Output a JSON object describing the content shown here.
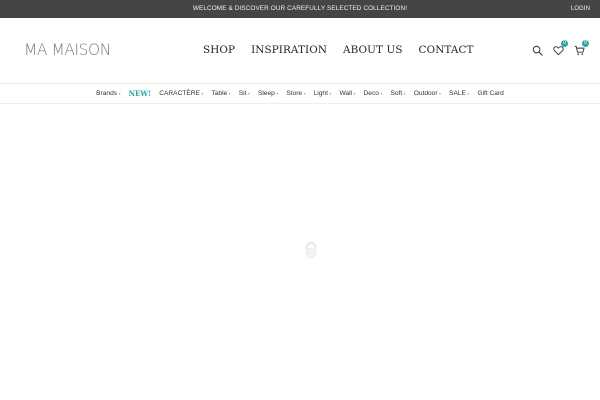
{
  "topbar": {
    "welcome": "WELCOME & DISCOVER OUR CAREFULLY SELECTED COLLECTION!",
    "login": "LOGIN"
  },
  "header": {
    "logo": "MA MAISON",
    "nav": [
      "SHOP",
      "INSPIRATION",
      "ABOUT US",
      "CONTACT"
    ],
    "wishlist_count": "0",
    "cart_count": "0"
  },
  "categories": [
    {
      "label": "Brands",
      "has_dropdown": true
    },
    {
      "label": "NEW!",
      "has_dropdown": false,
      "highlight": true
    },
    {
      "label": "CARACTÈRE",
      "has_dropdown": true
    },
    {
      "label": "Table",
      "has_dropdown": true
    },
    {
      "label": "Sit",
      "has_dropdown": true
    },
    {
      "label": "Sleep",
      "has_dropdown": true
    },
    {
      "label": "Store",
      "has_dropdown": true
    },
    {
      "label": "Light",
      "has_dropdown": true
    },
    {
      "label": "Wall",
      "has_dropdown": true
    },
    {
      "label": "Deco",
      "has_dropdown": true
    },
    {
      "label": "Soft",
      "has_dropdown": true
    },
    {
      "label": "Outdoor",
      "has_dropdown": true
    },
    {
      "label": "SALE",
      "has_dropdown": true
    },
    {
      "label": "Gift Card",
      "has_dropdown": false
    }
  ],
  "icons": {
    "search": "search-icon",
    "wishlist": "heart-icon",
    "cart": "cart-icon",
    "dropdown": "chevron-down-icon",
    "loader": "loading-spinner-icon"
  },
  "colors": {
    "topbar_bg": "#454545",
    "accent": "#2aa5a0"
  }
}
